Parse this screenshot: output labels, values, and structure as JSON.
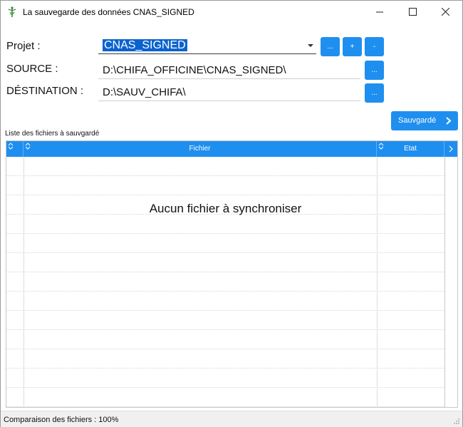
{
  "window": {
    "title": "La sauvegarde des données CNAS_SIGNED",
    "icon": "caduceus-icon"
  },
  "form": {
    "project_label": "Projet :",
    "project_value": "CNAS_SIGNED",
    "source_label": "SOURCE :",
    "source_value": "D:\\CHIFA_OFFICINE\\CNAS_SIGNED\\",
    "destination_label": "DÉSTINATION :",
    "destination_value": "D:\\SAUV_CHIFA\\",
    "browse_label": "...",
    "add_label": "+",
    "remove_label": "-"
  },
  "actions": {
    "save_label": "Sauvgardé"
  },
  "list": {
    "caption": "Liste des fichiers à sauvgardé",
    "columns": [
      "",
      "Fichier",
      "Etat"
    ],
    "empty_message": "Aucun fichier à synchroniser",
    "rows": []
  },
  "status": {
    "text": "Comparaison des fichiers : 100%"
  },
  "colors": {
    "accent": "#1f8fef",
    "selection": "#0a63cf"
  }
}
